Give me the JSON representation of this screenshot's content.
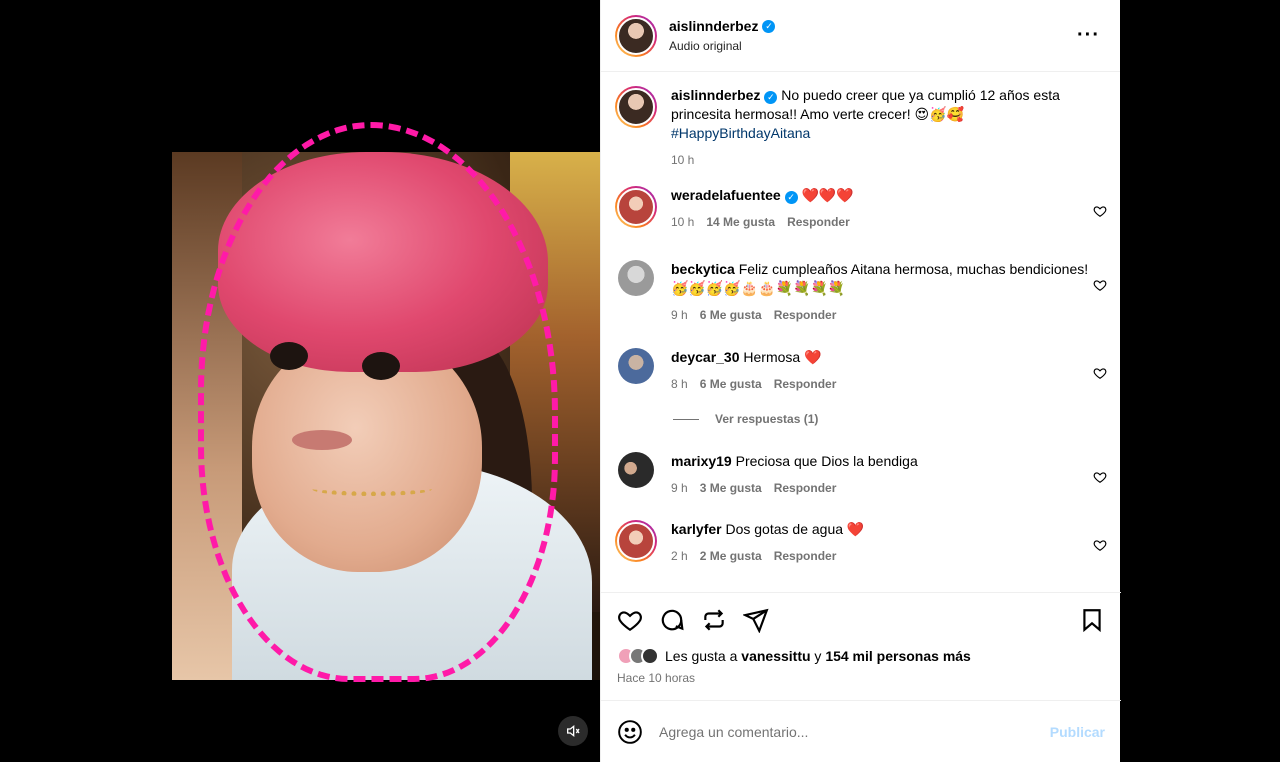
{
  "post": {
    "author": "aislinnderbez",
    "audio": "Audio original"
  },
  "caption": {
    "user": "aislinnderbez",
    "text": "No puedo creer que ya cumplió 12 años esta princesita hermosa!! Amo verte crecer! 😍🥳🥰",
    "hashtag": "#HappyBirthdayAitana",
    "time": "10 h"
  },
  "comments": [
    {
      "user": "weradelafuentee",
      "verified": true,
      "text": "❤️❤️❤️",
      "time": "10 h",
      "likes": "14 Me gusta",
      "reply": "Responder"
    },
    {
      "user": "beckytica",
      "verified": false,
      "text": "Feliz cumpleaños Aitana hermosa, muchas bendiciones!🥳🥳🥳🥳🎂🎂💐💐💐💐",
      "time": "9 h",
      "likes": "6 Me gusta",
      "reply": "Responder"
    },
    {
      "user": "deycar_30",
      "verified": false,
      "text": "Hermosa ❤️",
      "time": "8 h",
      "likes": "6 Me gusta",
      "reply": "Responder"
    },
    {
      "user": "marixy19",
      "verified": false,
      "text": "Preciosa que Dios la bendiga",
      "time": "9 h",
      "likes": "3 Me gusta",
      "reply": "Responder"
    },
    {
      "user": "karlyfer",
      "verified": false,
      "text": "Dos gotas de agua ❤️",
      "time": "2 h",
      "likes": "2 Me gusta",
      "reply": "Responder"
    }
  ],
  "view_replies": "Ver respuestas (1)",
  "likes_line": {
    "prefix": "Les gusta a",
    "user": "vanessittu",
    "joiner": "y",
    "others": "154 mil personas más"
  },
  "posted_ago": "Hace 10 horas",
  "composer": {
    "placeholder": "Agrega un comentario...",
    "publish": "Publicar"
  },
  "icons": {
    "mute": "speaker-muted-icon",
    "more": "more-options-icon",
    "like": "heart-icon",
    "comment": "comment-bubble-icon",
    "share": "share-repost-icon",
    "send": "send-paper-plane-icon",
    "save": "bookmark-icon",
    "emoji": "smiley-icon"
  },
  "colors": {
    "verified": "#0095f6",
    "link": "#00376b",
    "muted_text": "#737373",
    "publish_disabled": "#b3dbff",
    "outline_pink": "#ff1aa8"
  }
}
